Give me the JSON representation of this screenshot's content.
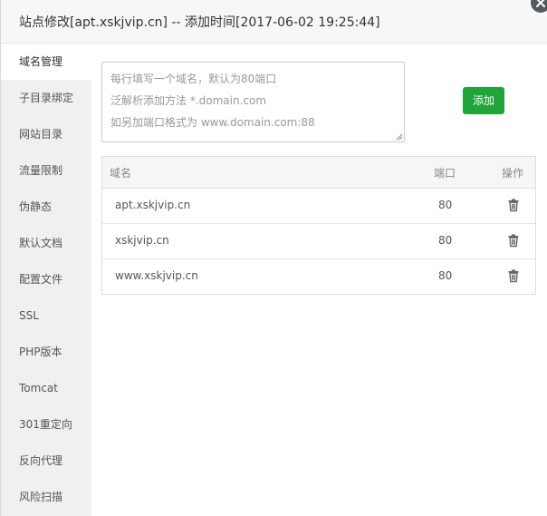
{
  "dialog": {
    "title": "站点修改[apt.xskjvip.cn] -- 添加时间[2017-06-02 19:25:44]"
  },
  "sidebar": {
    "items": [
      {
        "label": "域名管理",
        "active": true
      },
      {
        "label": "子目录绑定"
      },
      {
        "label": "网站目录"
      },
      {
        "label": "流量限制"
      },
      {
        "label": "伪静态"
      },
      {
        "label": "默认文档"
      },
      {
        "label": "配置文件"
      },
      {
        "label": "SSL"
      },
      {
        "label": "PHP版本"
      },
      {
        "label": "Tomcat"
      },
      {
        "label": "301重定向"
      },
      {
        "label": "反向代理"
      },
      {
        "label": "风险扫描"
      }
    ]
  },
  "domain_input": {
    "placeholder_lines": [
      "每行填写一个域名，默认为80端口",
      "泛解析添加方法 *.domain.com",
      "如另加端口格式为 www.domain.com:88"
    ],
    "value": ""
  },
  "add_button": {
    "label": "添加",
    "color": "#20a53a"
  },
  "table": {
    "headers": {
      "domain": "域名",
      "port": "端口",
      "ops": "操作"
    },
    "rows": [
      {
        "domain": "apt.xskjvip.cn",
        "port": "80"
      },
      {
        "domain": "xskjvip.cn",
        "port": "80"
      },
      {
        "domain": "www.xskjvip.cn",
        "port": "80"
      }
    ],
    "delete_icon": "trash-icon"
  }
}
